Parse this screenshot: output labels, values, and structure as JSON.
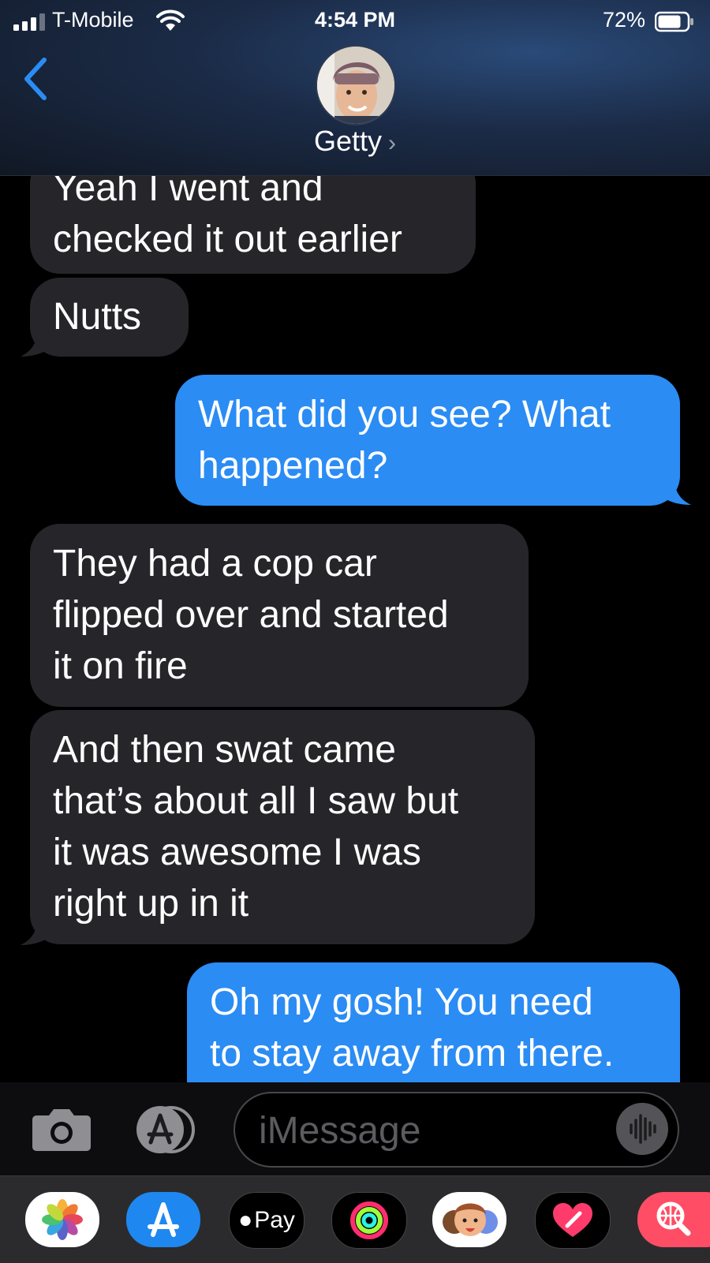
{
  "status_bar": {
    "carrier": "T-Mobile",
    "time": "4:54 PM",
    "battery": "72%"
  },
  "header": {
    "contact_name": "Getty"
  },
  "messages": [
    {
      "from": "them",
      "text": "Yeah I went and\nchecked it out earlier"
    },
    {
      "from": "them",
      "text": "Nutts"
    },
    {
      "from": "me",
      "text": "What did you see? What\nhappened?"
    },
    {
      "from": "them",
      "text": "They had a cop car\nflipped over and started\nit on fire"
    },
    {
      "from": "them",
      "text": "And then swat came\nthat’s about all I saw but\nit was awesome I was\nright up in it"
    },
    {
      "from": "me",
      "text": "Oh my gosh! You need\nto stay away from there."
    }
  ],
  "composer": {
    "placeholder": "iMessage"
  },
  "app_drawer": {
    "items": [
      "photos-icon",
      "app-store-icon",
      "apple-pay-icon",
      "activity-icon",
      "memoji-icon",
      "digital-touch-icon",
      "web-search-icon"
    ],
    "apple_pay_label": "Pay"
  },
  "colors": {
    "incoming_bubble": "#26252a",
    "outgoing_bubble": "#2b8cf4",
    "accent": "#2b8cf4"
  }
}
